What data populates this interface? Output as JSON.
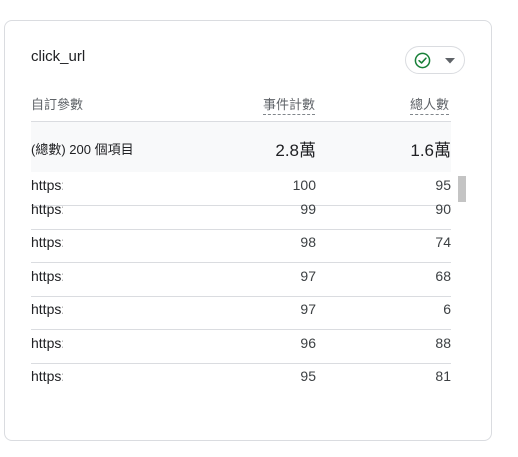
{
  "card": {
    "title": "click_url",
    "compare_icon": "check-circle-icon",
    "menu_icon": "chevron-down-icon",
    "accent_color": "#188038"
  },
  "columns": {
    "dimension": "自訂參數",
    "metric1": "事件計數",
    "metric2": "總人數"
  },
  "totals": {
    "label": "(總數) 200 個項目",
    "metric1": "2.8萬",
    "metric2": "1.6萬"
  },
  "rows": [
    {
      "url": "https:/",
      "metric1": "100",
      "metric2": "95"
    },
    {
      "url": "https:/",
      "metric1": "99",
      "metric2": "90"
    },
    {
      "url": "https:/",
      "metric1": "98",
      "metric2": "74"
    },
    {
      "url": "https:/",
      "metric1": "97",
      "metric2": "68"
    },
    {
      "url": "https:/",
      "metric1": "97",
      "metric2": "6"
    },
    {
      "url": "https:/",
      "metric1": "96",
      "metric2": "88"
    },
    {
      "url": "https:/",
      "metric1": "95",
      "metric2": "81"
    }
  ]
}
